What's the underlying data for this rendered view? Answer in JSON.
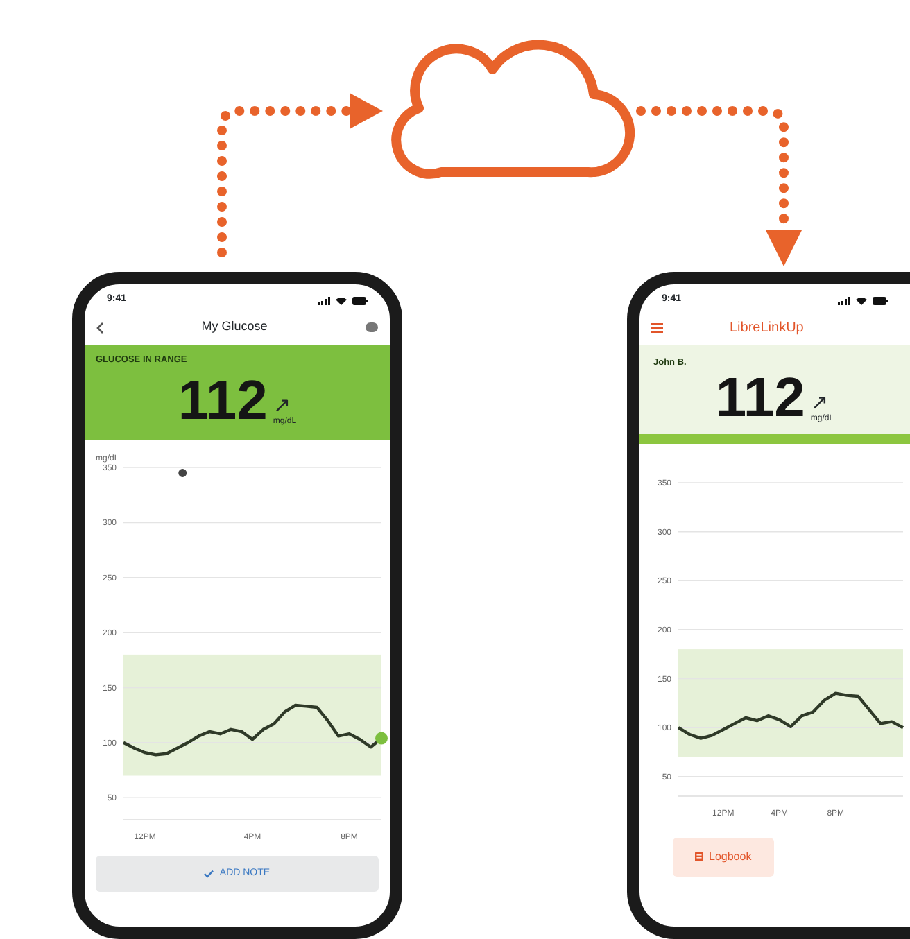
{
  "sender_phone": {
    "status_time": "9:41",
    "title": "My Glucose",
    "banner_label": "GLUCOSE IN RANGE",
    "reading": "112",
    "trend": "↗",
    "unit": "mg/dL",
    "button": "ADD NOTE",
    "chart_data": {
      "type": "line",
      "grid": true,
      "ylabel": "mg/dL",
      "ylim": [
        30,
        350
      ],
      "bands": [
        {
          "axis": "y",
          "from": 70,
          "to": 180
        }
      ],
      "yticks": [
        50,
        100,
        150,
        200,
        250,
        300,
        350
      ],
      "categories": [
        null,
        null,
        "12PM",
        null,
        null,
        null,
        null,
        null,
        null,
        null,
        null,
        null,
        "4PM",
        null,
        null,
        null,
        null,
        null,
        null,
        null,
        null,
        "8PM",
        null,
        null,
        null
      ],
      "series": [
        {
          "color": "#2f3a28",
          "values": [
            100,
            95,
            91,
            89,
            90,
            95,
            100,
            106,
            110,
            108,
            112,
            110,
            103,
            112,
            117,
            128,
            134,
            133,
            132,
            120,
            106,
            108,
            103,
            96,
            104
          ]
        }
      ]
    }
  },
  "receiver_phone": {
    "status_time": "9:41",
    "title": "LibreLinkUp",
    "name": "John B.",
    "reading": "112",
    "trend": "↗",
    "unit": "mg/dL",
    "button": "Logbook",
    "chart_data": {
      "type": "line",
      "grid": true,
      "ylim": [
        30,
        350
      ],
      "bands": [
        {
          "axis": "y",
          "from": 70,
          "to": 180
        }
      ],
      "yticks": [
        50,
        100,
        150,
        200,
        250,
        300,
        350
      ],
      "categories": [
        null,
        null,
        null,
        null,
        "12PM",
        null,
        null,
        null,
        null,
        "4PM",
        null,
        null,
        null,
        null,
        "8PM",
        null,
        null,
        null,
        null,
        null,
        null
      ],
      "series": [
        {
          "color": "#2f3a28",
          "values": [
            100,
            93,
            89,
            92,
            98,
            104,
            110,
            107,
            112,
            108,
            101,
            112,
            116,
            128,
            135,
            133,
            132,
            118,
            104,
            106,
            100
          ]
        }
      ]
    }
  }
}
